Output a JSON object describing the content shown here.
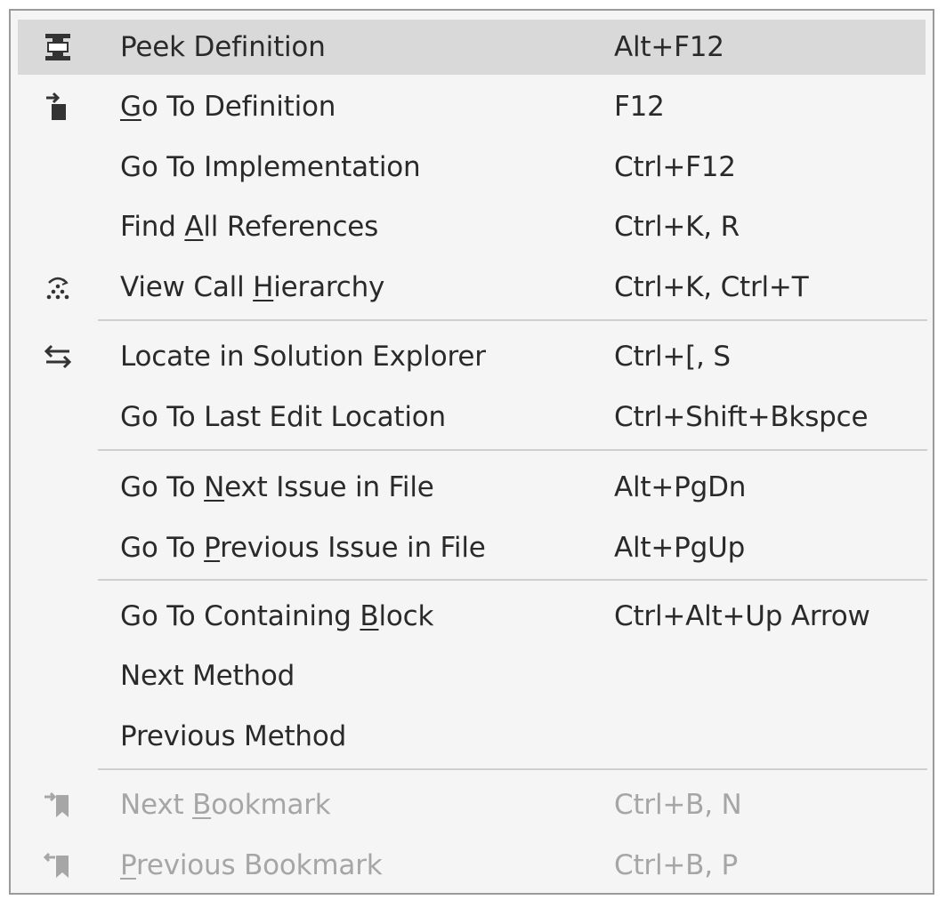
{
  "menu": {
    "items": [
      {
        "pre": "",
        "key": "",
        "post": "Peek Definition",
        "shortcut": "Alt+F12",
        "icon": "peek-definition-icon",
        "highlighted": true,
        "disabled": false
      },
      {
        "pre": "",
        "key": "G",
        "post": "o To Definition",
        "shortcut": "F12",
        "icon": "go-to-definition-icon",
        "highlighted": false,
        "disabled": false
      },
      {
        "pre": "Go To Implementation",
        "key": "",
        "post": "",
        "shortcut": "Ctrl+F12",
        "icon": "",
        "highlighted": false,
        "disabled": false
      },
      {
        "pre": "Find ",
        "key": "A",
        "post": "ll References",
        "shortcut": "Ctrl+K, R",
        "icon": "",
        "highlighted": false,
        "disabled": false
      },
      {
        "pre": "View Call ",
        "key": "H",
        "post": "ierarchy",
        "shortcut": "Ctrl+K, Ctrl+T",
        "icon": "call-hierarchy-icon",
        "highlighted": false,
        "disabled": false
      },
      {
        "pre": "Locate in Solution Explorer",
        "key": "",
        "post": "",
        "shortcut": "Ctrl+[, S",
        "icon": "sync-arrows-icon",
        "highlighted": false,
        "disabled": false
      },
      {
        "pre": "Go To Last Edit Location",
        "key": "",
        "post": "",
        "shortcut": "Ctrl+Shift+Bkspce",
        "icon": "",
        "highlighted": false,
        "disabled": false
      },
      {
        "pre": "Go To ",
        "key": "N",
        "post": "ext Issue in File",
        "shortcut": "Alt+PgDn",
        "icon": "",
        "highlighted": false,
        "disabled": false
      },
      {
        "pre": "Go To ",
        "key": "P",
        "post": "revious Issue in File",
        "shortcut": "Alt+PgUp",
        "icon": "",
        "highlighted": false,
        "disabled": false
      },
      {
        "pre": "Go To Containing ",
        "key": "B",
        "post": "lock",
        "shortcut": "Ctrl+Alt+Up Arrow",
        "icon": "",
        "highlighted": false,
        "disabled": false
      },
      {
        "pre": "Next Method",
        "key": "",
        "post": "",
        "shortcut": "",
        "icon": "",
        "highlighted": false,
        "disabled": false
      },
      {
        "pre": "Previous Method",
        "key": "",
        "post": "",
        "shortcut": "",
        "icon": "",
        "highlighted": false,
        "disabled": false
      },
      {
        "pre": "Next ",
        "key": "B",
        "post": "ookmark",
        "shortcut": "Ctrl+B, N",
        "icon": "next-bookmark-icon",
        "highlighted": false,
        "disabled": true
      },
      {
        "pre": "",
        "key": "P",
        "post": "revious Bookmark",
        "shortcut": "Ctrl+B, P",
        "icon": "previous-bookmark-icon",
        "highlighted": false,
        "disabled": true
      }
    ]
  },
  "colors": {
    "menu_background": "#f5f5f5",
    "highlight": "#d9d9d9",
    "text": "#2a2a2a",
    "disabled_text": "#a6a6a6",
    "separator": "#cfcfcf"
  }
}
